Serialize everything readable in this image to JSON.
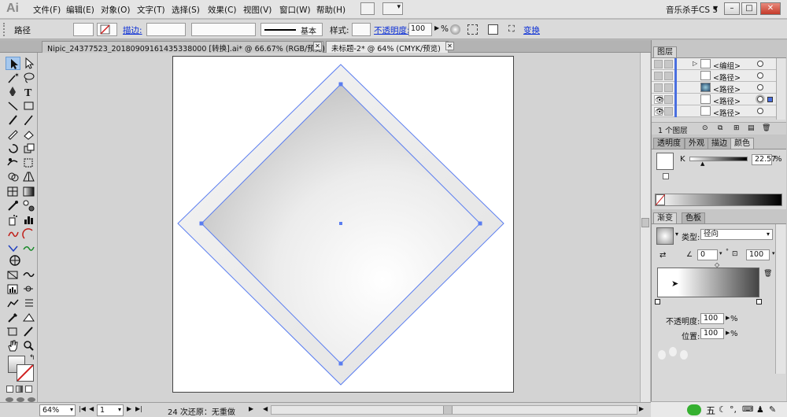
{
  "app": {
    "logo": "Ai"
  },
  "menu": [
    "文件(F)",
    "编辑(E)",
    "对象(O)",
    "文字(T)",
    "选择(S)",
    "效果(C)",
    "视图(V)",
    "窗口(W)",
    "帮助(H)"
  ],
  "workspace": {
    "name": "音乐杀手CS 5",
    "min": "–",
    "max": "□",
    "close": "✕"
  },
  "control": {
    "selection_type": "路径",
    "stroke_link": "描边:",
    "stroke_profile": "基本",
    "style_label": "样式:",
    "opacity_link": "不透明度:",
    "opacity_value": "100",
    "opacity_unit": "%",
    "transform_link": "变换"
  },
  "tabs": [
    {
      "label": "Nipic_24377523_20180909161435338000 [转换].ai* @ 66.67% (RGB/预览)",
      "active": false
    },
    {
      "label": "未标题-2* @ 64% (CMYK/预览)",
      "active": true
    }
  ],
  "tab_close": "✕",
  "status": {
    "zoom": "64%",
    "artboard": "1",
    "info": "24 次还原：无重做"
  },
  "layers_panel": {
    "title": "图层",
    "rows": [
      {
        "name": "<编组>",
        "thumb": "group"
      },
      {
        "name": "<路径>",
        "thumb": "white"
      },
      {
        "name": "<路径>",
        "thumb": "blue"
      },
      {
        "name": "<路径>",
        "thumb": "white"
      },
      {
        "name": "<路径>",
        "thumb": "white"
      }
    ],
    "footer": "1 个图层"
  },
  "color_panel": {
    "tabs": [
      "透明度",
      "外观",
      "描边",
      "颜色"
    ],
    "channel": "K",
    "value": "22.57",
    "unit": "%"
  },
  "gradient_panel": {
    "tabs": [
      "渐变",
      "色板"
    ],
    "type_label": "类型:",
    "type_value": "径向",
    "angle": "0",
    "degree": "°",
    "aspect": "100",
    "opacity_label": "不透明度:",
    "opacity_value": "100",
    "location_label": "位置:",
    "location_value": "100",
    "unit": "%"
  },
  "taskbar": {
    "ime": "五"
  },
  "colors": {
    "selection": "#5a7df0",
    "accent_blue": "#0b2fd6"
  }
}
